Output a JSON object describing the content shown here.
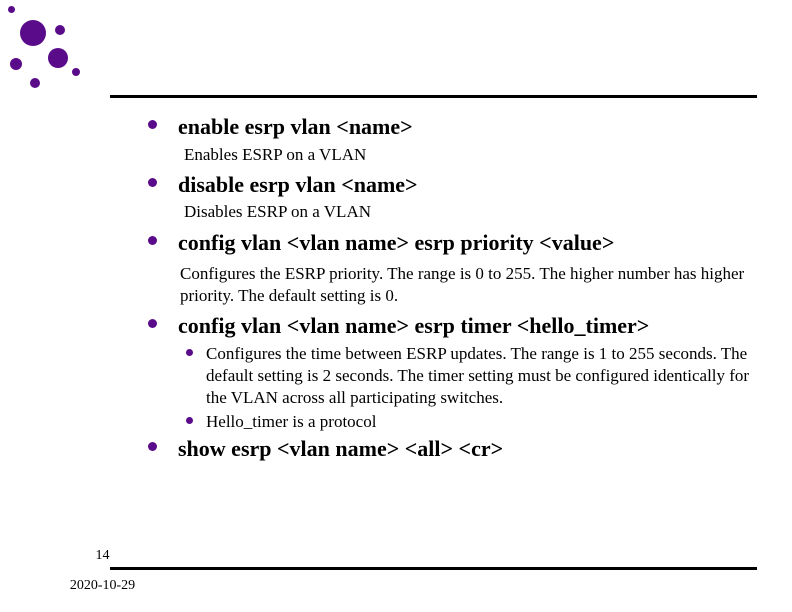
{
  "slide_number": "14",
  "date": "2020-10-29",
  "items": [
    {
      "cmd": "enable esrp vlan <name>",
      "desc": "Enables ESRP on a VLAN"
    },
    {
      "cmd": "disable esrp vlan <name>",
      "desc": "Disables ESRP on a VLAN"
    },
    {
      "cmd": "config vlan <vlan name> esrp priority <value>",
      "desc": "Configures the ESRP priority. The range is 0 to 255. The higher number has higher priority. The default setting is 0."
    },
    {
      "cmd": "config vlan <vlan name> esrp timer <hello_timer>",
      "subs": [
        "Configures the time between ESRP updates. The range is 1 to 255 seconds. The default setting is 2 seconds. The timer setting must be configured identically for the VLAN across all participating switches.",
        "Hello_timer is a protocol"
      ]
    },
    {
      "cmd": "show esrp <vlan name> <all> <cr>"
    }
  ]
}
